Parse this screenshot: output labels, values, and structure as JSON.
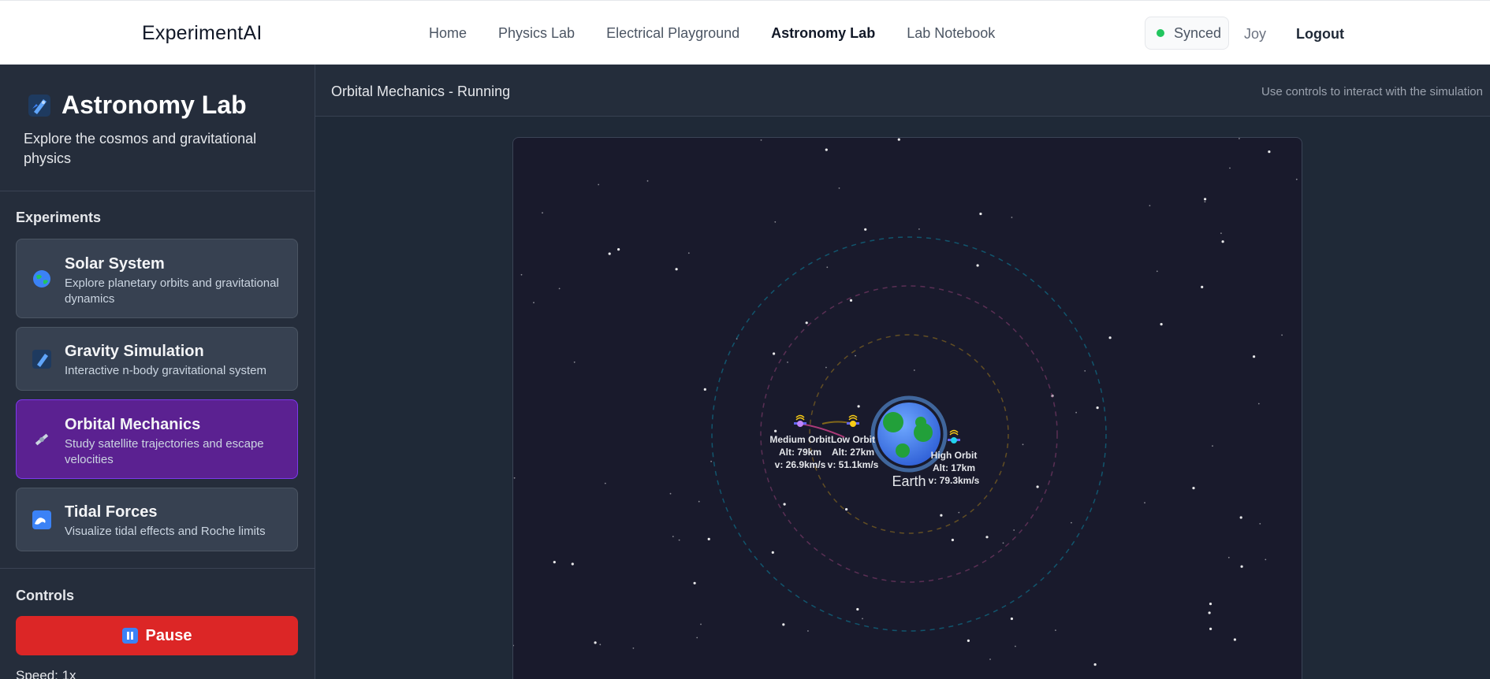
{
  "nav": {
    "brand": "ExperimentAI",
    "links": [
      "Home",
      "Physics Lab",
      "Electrical Playground",
      "Astronomy Lab",
      "Lab Notebook"
    ],
    "active_index": 3,
    "sync_status": "Synced",
    "user": "Joy",
    "logout": "Logout"
  },
  "sidebar": {
    "title": "Astronomy Lab",
    "title_icon": "rocket-icon",
    "subtitle": "Explore the cosmos and gravitational physics",
    "experiments_label": "Experiments",
    "experiments": [
      {
        "name": "Solar System",
        "desc": "Explore planetary orbits and gravitational dynamics",
        "icon": "globe-icon"
      },
      {
        "name": "Gravity Simulation",
        "desc": "Interactive n-body gravitational system",
        "icon": "rocket-icon"
      },
      {
        "name": "Orbital Mechanics",
        "desc": "Study satellite trajectories and escape velocities",
        "icon": "satellite-icon"
      },
      {
        "name": "Tidal Forces",
        "desc": "Visualize tidal effects and Roche limits",
        "icon": "wave-icon"
      }
    ],
    "active_experiment": 2,
    "controls_label": "Controls",
    "pause_label": "Pause",
    "speed_label": "Speed: 1x"
  },
  "main": {
    "title": "Orbital Mechanics - Running",
    "hint": "Use controls to interact with the simulation"
  },
  "simulation": {
    "planet_label": "Earth",
    "satellites": [
      {
        "name": "Medium Orbit",
        "altitude": "Alt: 79km",
        "velocity": "v: 26.9km/s",
        "color": "#c084fc"
      },
      {
        "name": "Low Orbit",
        "altitude": "Alt: 27km",
        "velocity": "v: 51.1km/s",
        "color": "#facc15"
      },
      {
        "name": "High Orbit",
        "altitude": "Alt: 17km",
        "velocity": "v: 79.3km/s",
        "color": "#22d3ee"
      }
    ],
    "colors": {
      "accent_purple": "#5b2191",
      "pause_red": "#dc2626",
      "sync_green": "#22c55e",
      "space_bg": "#191a2c"
    }
  }
}
